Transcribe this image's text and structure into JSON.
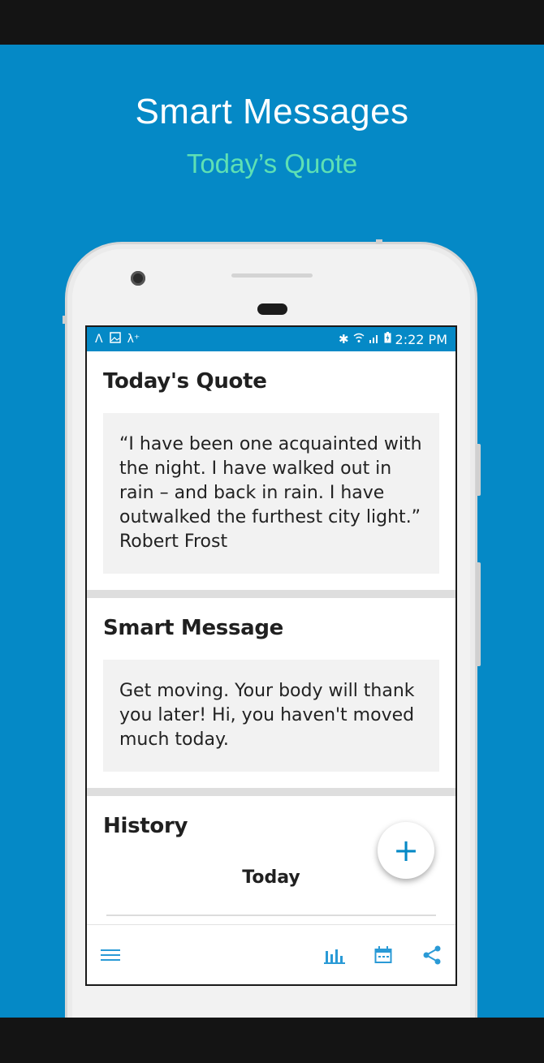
{
  "hero": {
    "title": "Smart Messages",
    "subtitle": "Today’s Quote"
  },
  "status_bar": {
    "time": "2:22 PM"
  },
  "quote_section": {
    "title": "Today's Quote",
    "text": "“I have been one acquainted with the night. I have walked out in rain – and back in rain. I have outwalked the furthest city light.” Robert Frost"
  },
  "message_section": {
    "title": "Smart Message",
    "text": "Get moving. Your body will thank you later! Hi, you haven't moved much today."
  },
  "history_section": {
    "title": "History",
    "day_label": "Today"
  },
  "fab": {
    "label": "+"
  },
  "bottom_nav": {
    "items": [
      "menu-icon",
      "bar-chart-icon",
      "calendar-icon",
      "share-icon"
    ]
  },
  "colors": {
    "brand_blue": "#0589c6",
    "accent_teal": "#5ee0b4",
    "icon_blue": "#2a9ad6"
  }
}
